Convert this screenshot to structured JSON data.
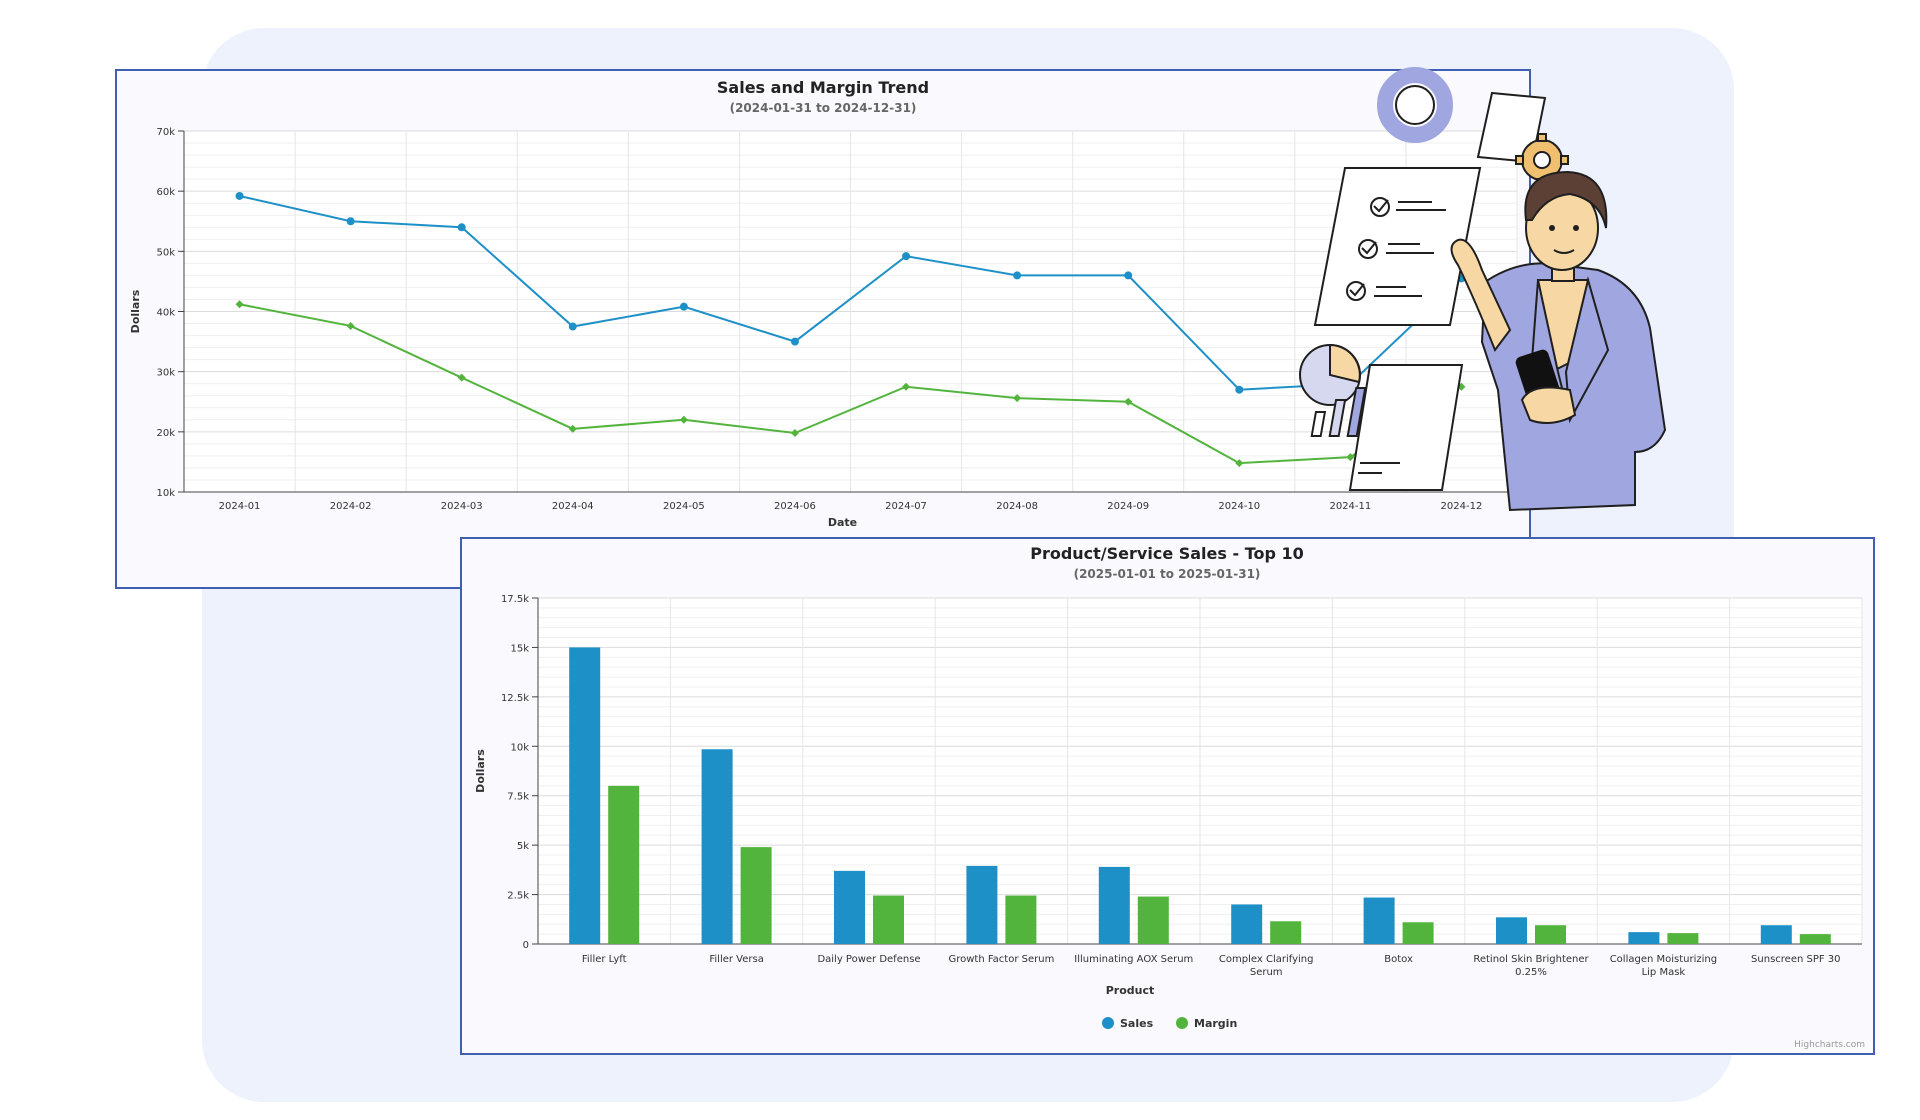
{
  "colors": {
    "sales": "#1e90c8",
    "margin": "#52b43c",
    "card_border": "#3f5fb1",
    "panel": "#eef2fd",
    "jacket": "#a0a6e0",
    "shirt": "#f7d7a3",
    "hair": "#5c4035",
    "gear": "#f0c070"
  },
  "illustration": {
    "name": "person-with-reports-illustration"
  },
  "chart_data": [
    {
      "type": "line",
      "title": "Sales and Margin Trend",
      "subtitle": "(2024-01-31 to 2024-12-31)",
      "xlabel": "Date",
      "ylabel": "Dollars",
      "categories": [
        "2024-01",
        "2024-02",
        "2024-03",
        "2024-04",
        "2024-05",
        "2024-06",
        "2024-07",
        "2024-08",
        "2024-09",
        "2024-10",
        "2024-11",
        "2024-12"
      ],
      "ylim": [
        10000,
        70000
      ],
      "yticks": [
        10000,
        20000,
        30000,
        40000,
        50000,
        60000,
        70000
      ],
      "yticklabels": [
        "10k",
        "20k",
        "30k",
        "40k",
        "50k",
        "60k",
        "70k"
      ],
      "grid": true,
      "series": [
        {
          "name": "Sales",
          "values": [
            59200,
            55000,
            54000,
            37500,
            40800,
            35000,
            49200,
            46000,
            46000,
            27000,
            28000,
            45500
          ]
        },
        {
          "name": "Margin",
          "values": [
            41200,
            37600,
            29000,
            20500,
            22000,
            19800,
            27500,
            25600,
            25000,
            14800,
            15800,
            27500
          ]
        }
      ]
    },
    {
      "type": "bar",
      "title": "Product/Service Sales - Top 10",
      "subtitle": "(2025-01-01 to 2025-01-31)",
      "xlabel": "Product",
      "ylabel": "Dollars",
      "categories": [
        [
          "Filler Lyft"
        ],
        [
          "Filler Versa"
        ],
        [
          "Daily Power Defense"
        ],
        [
          "Growth Factor Serum"
        ],
        [
          "Illuminating AOX Serum"
        ],
        [
          "Complex Clarifying",
          "Serum"
        ],
        [
          "Botox"
        ],
        [
          "Retinol Skin Brightener",
          "0.25%"
        ],
        [
          "Collagen Moisturizing",
          "Lip Mask"
        ],
        [
          "Sunscreen SPF 30"
        ]
      ],
      "ylim": [
        0,
        17500
      ],
      "yticks": [
        0,
        2500,
        5000,
        7500,
        10000,
        12500,
        15000,
        17500
      ],
      "yticklabels": [
        "0",
        "2.5k",
        "5k",
        "7.5k",
        "10k",
        "12.5k",
        "15k",
        "17.5k"
      ],
      "grid": true,
      "legend": "bottom-center",
      "credits": "Highcharts.com",
      "series": [
        {
          "name": "Sales",
          "values": [
            15000,
            9850,
            3700,
            3950,
            3900,
            2000,
            2350,
            1350,
            600,
            950
          ]
        },
        {
          "name": "Margin",
          "values": [
            8000,
            4900,
            2450,
            2450,
            2400,
            1150,
            1100,
            950,
            550,
            500
          ]
        }
      ]
    }
  ]
}
